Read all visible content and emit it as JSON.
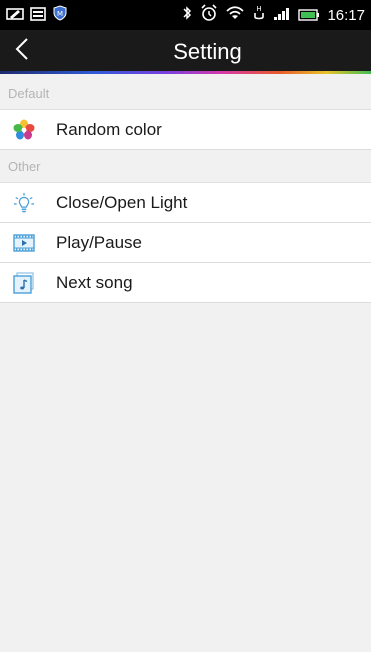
{
  "status_bar": {
    "time": "16:17",
    "icons": [
      "edit-icon",
      "message-icon",
      "shield-icon",
      "bluetooth-icon",
      "alarm-icon",
      "wifi-icon",
      "usb-debug-icon",
      "signal-icon",
      "battery-icon"
    ],
    "battery_color": "#3fbf54"
  },
  "header": {
    "title": "Setting",
    "back_icon": "chevron-left-icon"
  },
  "sections": {
    "default": {
      "title": "Default",
      "items": [
        {
          "label": "Random color",
          "icon": "flower-icon"
        }
      ]
    },
    "other": {
      "title": "Other",
      "items": [
        {
          "label": "Close/Open Light",
          "icon": "light-bulb-icon"
        },
        {
          "label": "Play/Pause",
          "icon": "play-icon"
        },
        {
          "label": "Next song",
          "icon": "music-note-icon"
        }
      ]
    }
  },
  "colors": {
    "header_bg": "#1a1a1a",
    "list_bg": "#ffffff",
    "page_bg": "#f1f1f1",
    "icon_blue": "#4aa0d8"
  }
}
